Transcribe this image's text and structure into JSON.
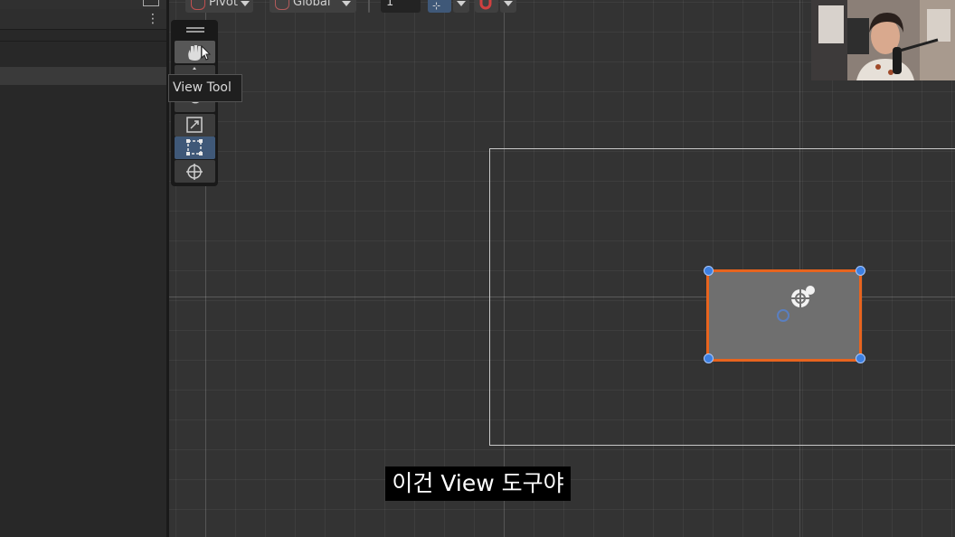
{
  "toolbar": {
    "pivot_label": "Pivot",
    "global_label": "Global",
    "snap_value": "1"
  },
  "tooltip": {
    "text": "View Tool"
  },
  "tools": [
    {
      "name": "view-tool",
      "active": false,
      "hovered": true
    },
    {
      "name": "move-tool",
      "active": false
    },
    {
      "name": "rotate-tool",
      "active": false
    },
    {
      "name": "scale-tool",
      "active": false
    },
    {
      "name": "rect-tool",
      "active": true
    },
    {
      "name": "transform-tool",
      "active": false
    }
  ],
  "subtitle": {
    "text": "이건 View 도구야"
  },
  "colors": {
    "selection_outline": "#e8641e",
    "handle": "#3d7fe0",
    "active_tool": "#3f5878",
    "scene_bg": "#333333"
  }
}
